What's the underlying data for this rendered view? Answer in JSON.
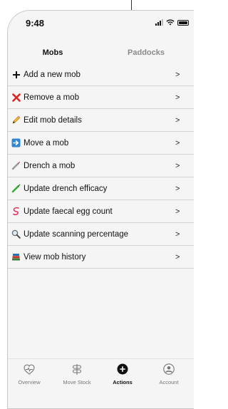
{
  "status": {
    "time": "9:48"
  },
  "tabs": [
    {
      "label": "Mobs",
      "active": true
    },
    {
      "label": "Paddocks",
      "active": false
    }
  ],
  "actions": [
    {
      "label": "Add a new mob",
      "icon": "plus-icon"
    },
    {
      "label": "Remove a mob",
      "icon": "red-x-icon"
    },
    {
      "label": "Edit mob details",
      "icon": "pencil-icon"
    },
    {
      "label": "Move a mob",
      "icon": "right-arrow-icon"
    },
    {
      "label": "Drench a mob",
      "icon": "syringe-icon"
    },
    {
      "label": "Update drench efficacy",
      "icon": "green-syringe-icon"
    },
    {
      "label": "Update faecal egg count",
      "icon": "worm-icon"
    },
    {
      "label": "Update scanning percentage",
      "icon": "magnifier-icon"
    },
    {
      "label": "View mob history",
      "icon": "books-icon"
    }
  ],
  "chevron": ">",
  "bottom_nav": [
    {
      "label": "Overview",
      "icon": "heart-pulse-icon",
      "active": false
    },
    {
      "label": "Move Stock",
      "icon": "signpost-icon",
      "active": false
    },
    {
      "label": "Actions",
      "icon": "plus-circle-icon",
      "active": true
    },
    {
      "label": "Account",
      "icon": "user-circle-icon",
      "active": false
    }
  ],
  "colors": {
    "accent": "#111111",
    "remove": "#e02424",
    "move": "#2f86d6",
    "drench": "#3aa83a"
  }
}
